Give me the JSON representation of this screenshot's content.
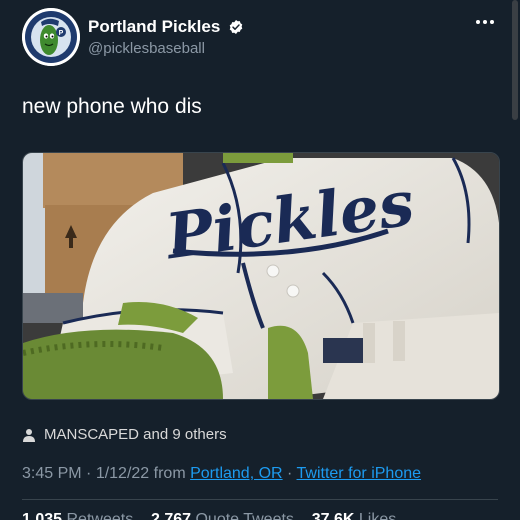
{
  "header": {
    "display_name": "Portland Pickles",
    "handle": "@picklesbaseball",
    "avatar_icon": "pickle-mascot-logo",
    "verified_icon": "verified-badge-icon",
    "more_icon": "more-options-icon"
  },
  "tweet": {
    "text": "new phone who dis"
  },
  "media": {
    "jersey_word": "Pickles"
  },
  "social_context": {
    "icon": "person-icon",
    "text": "MANSCAPED and 9 others"
  },
  "meta": {
    "time": "3:45 PM",
    "sep1": " · ",
    "date": "1/12/22",
    "from": " from ",
    "location": "Portland, OR",
    "sep2": " · ",
    "client": "Twitter for iPhone"
  },
  "stats": {
    "retweets_value": "1,035",
    "retweets_label": "Retweets",
    "quotes_value": "2,767",
    "quotes_label": "Quote Tweets",
    "likes_value": "37.6K",
    "likes_label": "Likes"
  },
  "colors": {
    "background": "#15202b",
    "link": "#1d9bf0",
    "muted": "#8b98a5"
  }
}
